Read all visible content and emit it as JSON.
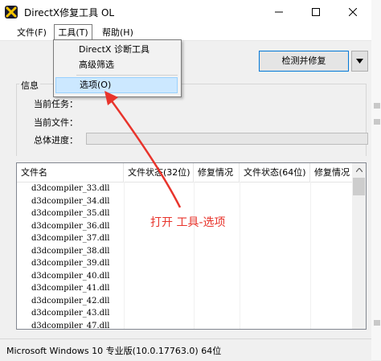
{
  "window": {
    "title": "DirectX修复工具 OL",
    "icon": "directx-repair-icon"
  },
  "menubar": {
    "file": "文件(F)",
    "tools": "工具(T)",
    "help": "帮助(H)"
  },
  "tools_menu": {
    "items": [
      "DirectX 诊断工具",
      "高级筛选",
      "选项(O)"
    ],
    "highlighted": "选项(O)"
  },
  "toolbar": {
    "detect_button": "检测并修复"
  },
  "info": {
    "group_label": "信息",
    "current_task_label": "当前任务：",
    "current_file_label": "当前文件：",
    "overall_progress_label": "总体进度："
  },
  "table": {
    "columns": [
      "文件名",
      "文件状态(32位)",
      "修复情况",
      "文件状态(64位)",
      "修复情况"
    ],
    "rows": [
      "d3dcompiler_33.dll",
      "d3dcompiler_34.dll",
      "d3dcompiler_35.dll",
      "d3dcompiler_36.dll",
      "d3dcompiler_37.dll",
      "d3dcompiler_38.dll",
      "d3dcompiler_39.dll",
      "d3dcompiler_40.dll",
      "d3dcompiler_41.dll",
      "d3dcompiler_42.dll",
      "d3dcompiler_43.dll",
      "d3dcompiler_47.dll"
    ]
  },
  "statusbar": {
    "text": "Microsoft Windows 10 专业版(10.0.17763.0) 64位"
  },
  "annotation": {
    "text": "打开  工具-选项",
    "color": "#e8342c"
  },
  "colors": {
    "highlight": "#cce8ff",
    "focus_border": "#0078d7"
  }
}
